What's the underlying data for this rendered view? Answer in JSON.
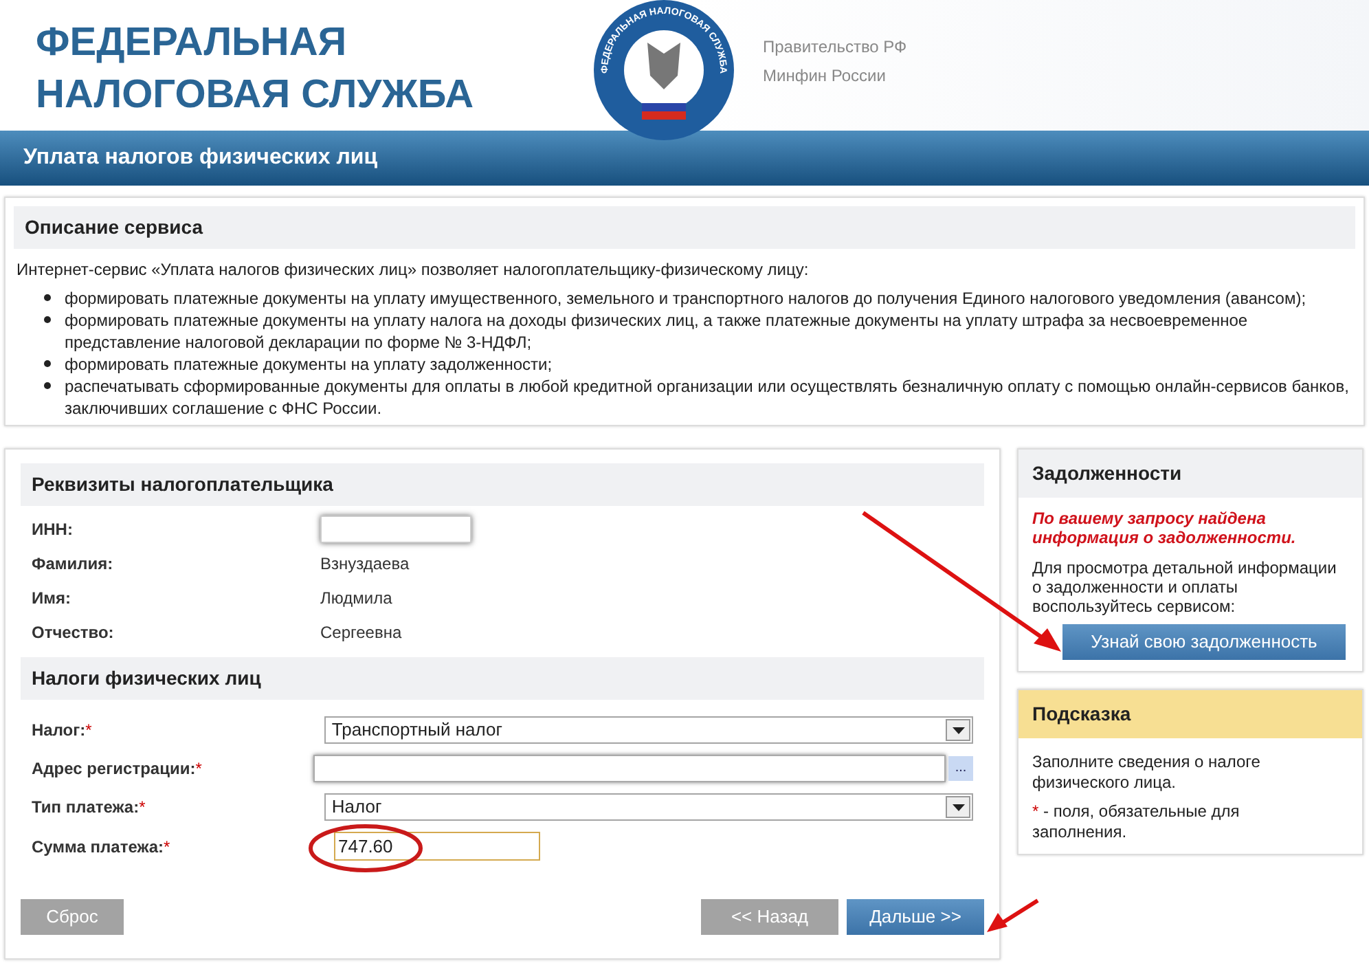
{
  "header": {
    "title_lines": [
      "ФЕДЕРАЛЬНАЯ",
      "НАЛОГОВАЯ СЛУЖБА"
    ],
    "emblem_text": "ФЕДЕРАЛЬНАЯ НАЛОГОВАЯ СЛУЖБА",
    "links": [
      "Правительство РФ",
      "Минфин России"
    ]
  },
  "banner": {
    "title": "Уплата налогов физических лиц"
  },
  "description": {
    "title": "Описание сервиса",
    "intro": "Интернет-сервис «Уплата налогов физических лиц» позволяет налогоплательщику-физическому лицу:",
    "items": [
      "формировать платежные документы на уплату имущественного, земельного и транспортного налогов до получения Единого налогового уведомления (авансом);",
      "формировать платежные документы на уплату налога на доходы физических лиц, а также платежные документы на уплату штрафа за несвоевременное представление налоговой декларации по форме № 3-НДФЛ;",
      "формировать платежные документы на уплату задолженности;",
      "распечатывать сформированные документы для оплаты в любой кредитной организации или осуществлять безналичную оплату с помощью онлайн-сервисов банков, заключивших соглашение с ФНС России."
    ]
  },
  "taxpayer": {
    "title": "Реквизиты налогоплательщика",
    "rows": [
      {
        "label": "ИНН:",
        "kind": "redacted"
      },
      {
        "label": "Фамилия:",
        "kind": "text",
        "value": "Взнуздаева"
      },
      {
        "label": "Имя:",
        "kind": "text",
        "value": "Людмила"
      },
      {
        "label": "Отчество:",
        "kind": "text",
        "value": "Сергеевна"
      }
    ]
  },
  "taxes": {
    "title": "Налоги физических лиц",
    "required_mark": "*",
    "fields": [
      {
        "label": "Налог:",
        "required": true,
        "kind": "select",
        "value": "Транспортный налог"
      },
      {
        "label": "Адрес регистрации:",
        "required": true,
        "kind": "lookup",
        "button_label": "..."
      },
      {
        "label": "Тип платежа:",
        "required": true,
        "kind": "select",
        "value": "Налог"
      },
      {
        "label": "Сумма платежа:",
        "required": true,
        "kind": "input",
        "value": "747.60"
      }
    ]
  },
  "buttons": {
    "reset": "Сброс",
    "back": "<< Назад",
    "next": "Дальше >>"
  },
  "debts": {
    "title": "Задолженности",
    "alert": "По вашему запросу найдена информация о задолженности.",
    "text": "Для просмотра детальной информации о задолженности и оплаты воспользуйтесь сервисом:",
    "button": "Узнай свою задолженность"
  },
  "hint": {
    "title": "Подсказка",
    "text": "Заполните сведения о налоге физического лица.",
    "mark": "*",
    "note": " - поля, обязательные для заполнения."
  }
}
